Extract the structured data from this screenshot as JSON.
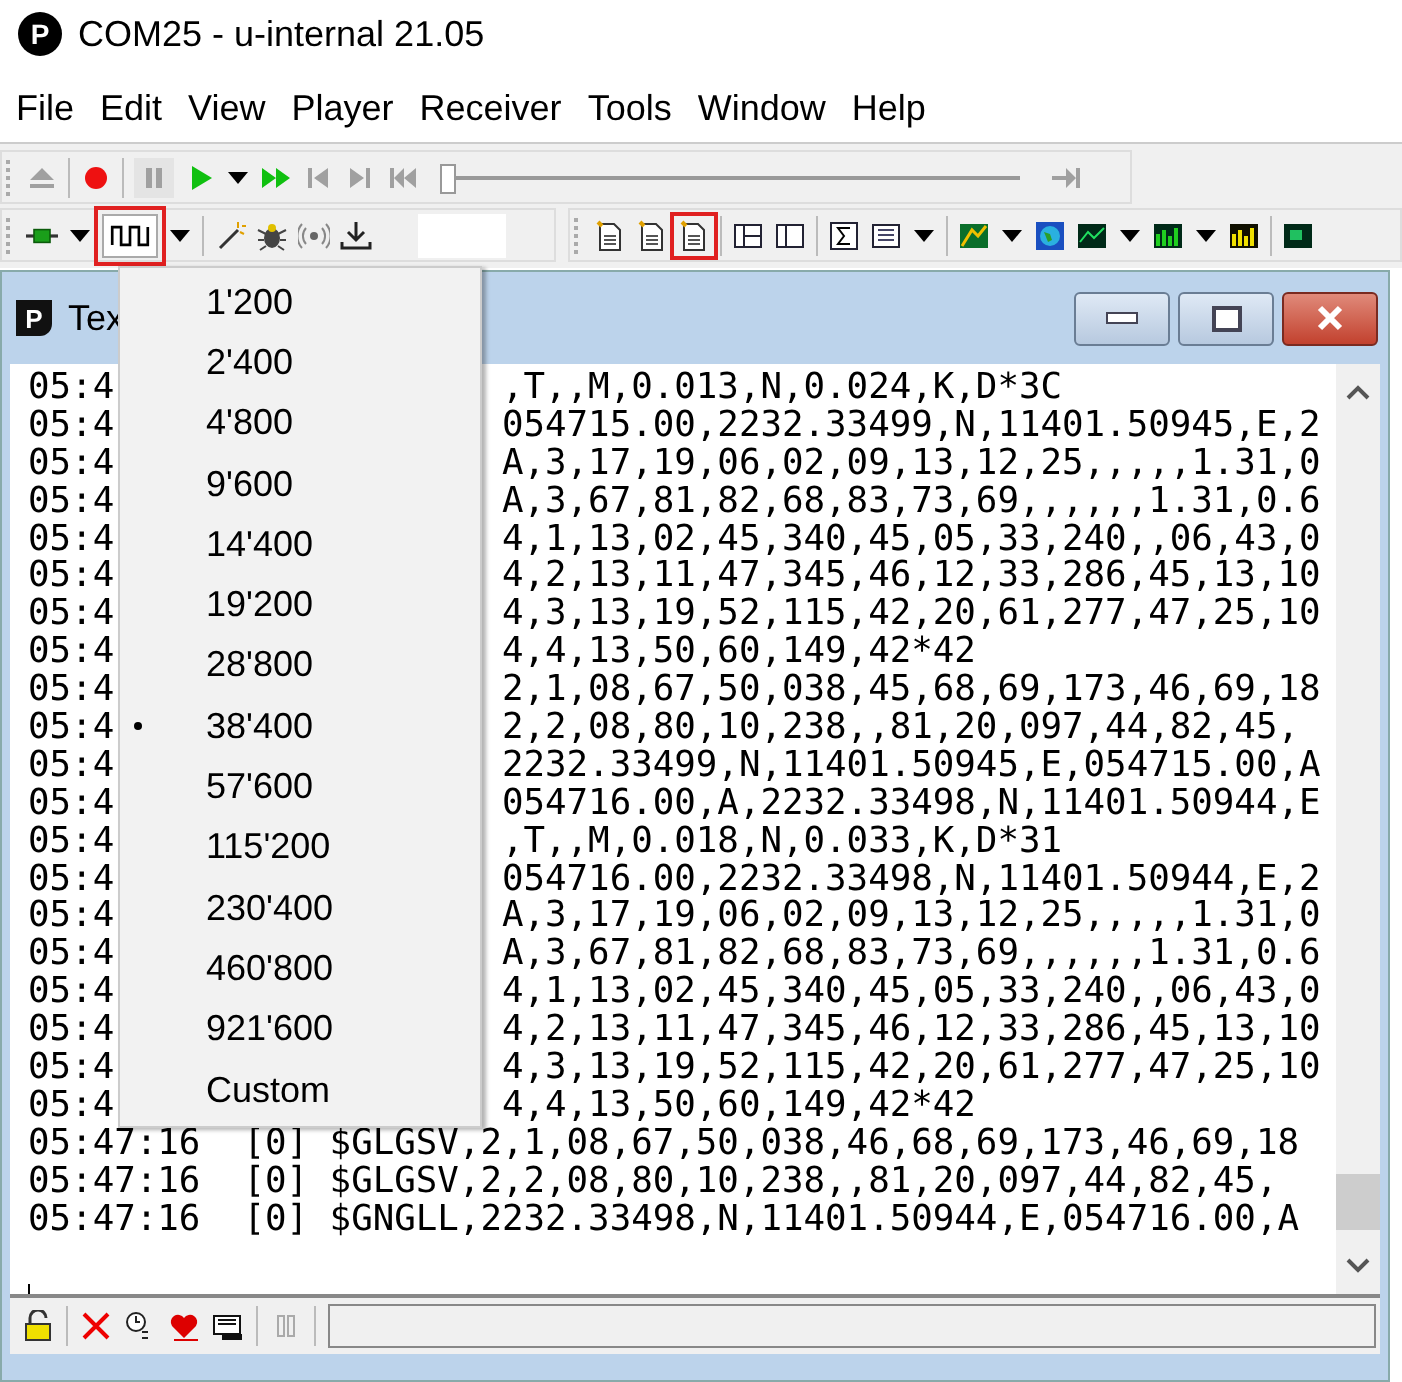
{
  "window": {
    "logo": "P",
    "title": "COM25 - u-internal 21.05"
  },
  "player": {
    "position": {
      "level": 0
    }
  },
  "menu_bar": [
    "File",
    "Edit",
    "View",
    "Player",
    "Receiver",
    "Tools",
    "Window",
    "Help"
  ],
  "child_window": {
    "logo": "P",
    "title": "Tex"
  },
  "console_lines": [
    {
      "time": "05:4",
      "text": ",T,,M,0.013,N,0.024,K,D*3C"
    },
    {
      "time": "05:4",
      "text": "054715.00,2232.33499,N,11401.50945,E,2"
    },
    {
      "time": "05:4",
      "text": "A,3,17,19,06,02,09,13,12,25,,,,,1.31,0"
    },
    {
      "time": "05:4",
      "text": "A,3,67,81,82,68,83,73,69,,,,,,1.31,0.6"
    },
    {
      "time": "05:4",
      "text": "4,1,13,02,45,340,45,05,33,240,,06,43,0"
    },
    {
      "time": "05:4",
      "text": "4,2,13,11,47,345,46,12,33,286,45,13,10"
    },
    {
      "time": "05:4",
      "text": "4,3,13,19,52,115,42,20,61,277,47,25,10"
    },
    {
      "time": "05:4",
      "text": "4,4,13,50,60,149,42*42"
    },
    {
      "time": "05:4",
      "text": "2,1,08,67,50,038,45,68,69,173,46,69,18"
    },
    {
      "time": "05:4",
      "text": "2,2,08,80,10,238,,81,20,097,44,82,45,"
    },
    {
      "time": "05:4",
      "text": "2232.33499,N,11401.50945,E,054715.00,A"
    },
    {
      "time": "05:4",
      "text": "054716.00,A,2232.33498,N,11401.50944,E"
    },
    {
      "time": "05:4",
      "text": ",T,,M,0.018,N,0.033,K,D*31"
    },
    {
      "time": "05:4",
      "text": "054716.00,2232.33498,N,11401.50944,E,2"
    },
    {
      "time": "05:4",
      "text": "A,3,17,19,06,02,09,13,12,25,,,,,1.31,0"
    },
    {
      "time": "05:4",
      "text": "A,3,67,81,82,68,83,73,69,,,,,,1.31,0.6"
    },
    {
      "time": "05:4",
      "text": "4,1,13,02,45,340,45,05,33,240,,06,43,0"
    },
    {
      "time": "05:4",
      "text": "4,2,13,11,47,345,46,12,33,286,45,13,10"
    },
    {
      "time": "05:4",
      "text": "4,3,13,19,52,115,42,20,61,277,47,25,10"
    },
    {
      "time": "05:4",
      "text": "4,4,13,50,60,149,42*42"
    },
    {
      "time": "05:47:16  [0] $GLGSV,2,1,08,67,50,038,46,68,69,173,46,69,18"
    },
    {
      "time": "05:47:16  [0] $GLGSV,2,2,08,80,10,238,,81,20,097,44,82,45,"
    },
    {
      "time": "05:47:16  [0] $GNGLL,2232.33498,N,11401.50944,E,054716.00,A"
    }
  ],
  "baud_menu": [
    {
      "label": "1'200",
      "selected": false
    },
    {
      "label": "2'400",
      "selected": false
    },
    {
      "label": "4'800",
      "selected": false
    },
    {
      "label": "9'600",
      "selected": false
    },
    {
      "label": "14'400",
      "selected": false
    },
    {
      "label": "19'200",
      "selected": false
    },
    {
      "label": "28'800",
      "selected": false
    },
    {
      "label": "38'400",
      "selected": true
    },
    {
      "label": "57'600",
      "selected": false
    },
    {
      "label": "115'200",
      "selected": false
    },
    {
      "label": "230'400",
      "selected": false
    },
    {
      "label": "460'800",
      "selected": false
    },
    {
      "label": "921'600",
      "selected": false
    },
    {
      "label": "Custom",
      "selected": false
    }
  ]
}
